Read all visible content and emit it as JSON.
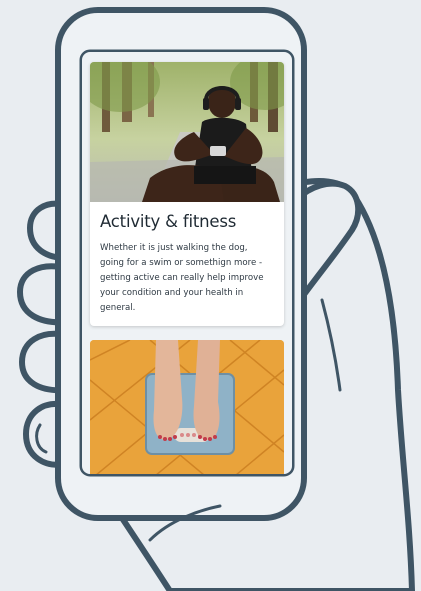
{
  "cards": [
    {
      "title": "Activity & fitness",
      "description": "Whether it is just walking the dog, going for a swim or somethign more - getting active can really help improve your condition and your health in general.",
      "image": "man-exercising-with-headphones-photo"
    },
    {
      "image": "feet-on-bathroom-scale-photo"
    }
  ],
  "colors": {
    "outline": "#3f5565",
    "background": "#e9edf1",
    "tile": "#e9a33b"
  }
}
